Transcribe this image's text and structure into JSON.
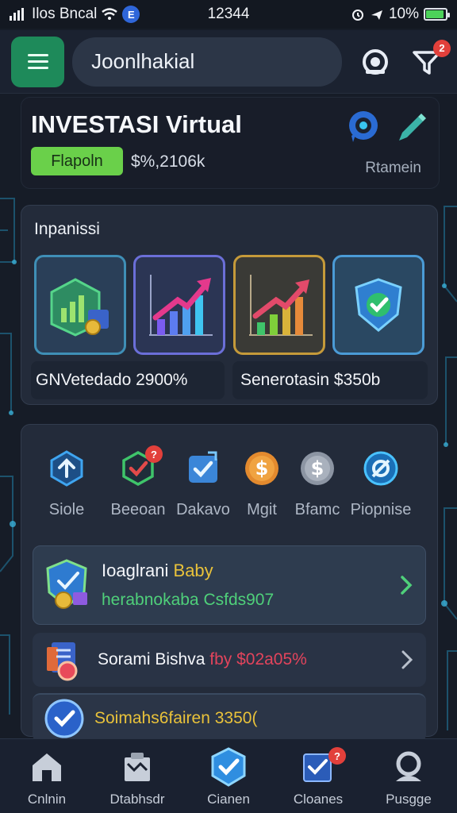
{
  "status_bar": {
    "carrier": "Ilos Bncal",
    "badge": "E",
    "time": "12344",
    "battery_text": "10%",
    "battery_level": 0.9
  },
  "header": {
    "search_value": "Joonlhakial",
    "notification_count": "2"
  },
  "title_card": {
    "title": "INVESTASI Virtual",
    "badge_label": "Flapoln",
    "value": "$%,2106k",
    "link_label": "Rtamein"
  },
  "investment": {
    "section_label": "Inpanissi",
    "tiles": [
      {
        "icon": "building-chart-icon"
      },
      {
        "icon": "growth-chart-icon"
      },
      {
        "icon": "growth-chart-icon"
      },
      {
        "icon": "shield-check-icon"
      }
    ],
    "captions": [
      {
        "text": "GNVetedado  2900%"
      },
      {
        "text": "Senerotasin  $350b"
      }
    ]
  },
  "quick_actions": [
    {
      "label": "Siole",
      "icon": "upload-icon"
    },
    {
      "label": "Beeoan",
      "icon": "shield-check-icon",
      "badge": "?"
    },
    {
      "label": "Dakavo",
      "icon": "check-box-icon"
    },
    {
      "label": "Mgit",
      "icon": "dollar-coin-icon"
    },
    {
      "label": "Bfamc",
      "icon": "silver-dollar-icon"
    },
    {
      "label": "Piopnise",
      "icon": "settings-ring-icon"
    }
  ],
  "list_rows": [
    {
      "title_white": "Ioaglrani",
      "title_yellow": "Baby",
      "subtitle": "herabnokaba Csfds907",
      "icon": "shield-coin-icon"
    },
    {
      "title_white": "Sorami Bishva",
      "title_red": "fby $02a05%",
      "icon": "report-coin-icon"
    },
    {
      "title_yellow": "Soimahs6fairen 3350(",
      "icon": "check-circle-icon"
    }
  ],
  "bottom_nav": [
    {
      "label": "Cnlnin",
      "icon": "home-icon"
    },
    {
      "label": "Dtabhsdr",
      "icon": "portfolio-icon"
    },
    {
      "label": "Cianen",
      "icon": "shield-check-icon"
    },
    {
      "label": "Cloanes",
      "icon": "task-icon",
      "badge": "?"
    },
    {
      "label": "Pusgge",
      "icon": "profile-icon"
    }
  ],
  "colors": {
    "background": "#161c27",
    "accent_green": "#6ad04a",
    "menu_green": "#1e8a5a",
    "highlight_yellow": "#e9c23a",
    "highlight_red": "#e2445c",
    "subtitle_green": "#4fd07a",
    "notification_red": "#e2403b"
  }
}
